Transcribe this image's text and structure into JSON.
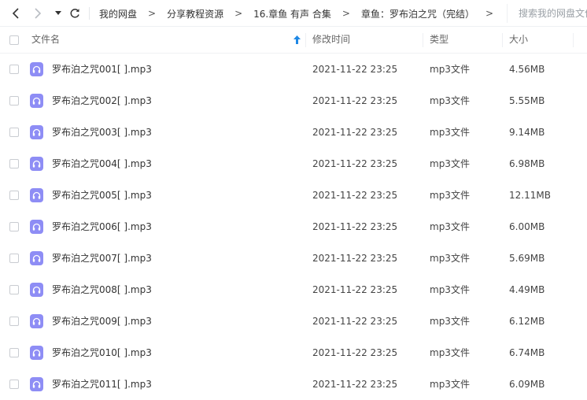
{
  "breadcrumb": [
    "我的网盘",
    "分享教程资源",
    "16.章鱼 有声 合集",
    "章鱼：罗布泊之咒（完结）"
  ],
  "breadcrumb_sep": ">",
  "search": {
    "placeholder": "搜索我的网盘文件"
  },
  "columns": {
    "name": "文件名",
    "modified": "修改时间",
    "type": "类型",
    "size": "大小"
  },
  "files": [
    {
      "name": "罗布泊之咒001[ ].mp3",
      "modified": "2021-11-22 23:25",
      "type": "mp3文件",
      "size": "4.56MB"
    },
    {
      "name": "罗布泊之咒002[ ].mp3",
      "modified": "2021-11-22 23:25",
      "type": "mp3文件",
      "size": "5.55MB"
    },
    {
      "name": "罗布泊之咒003[ ].mp3",
      "modified": "2021-11-22 23:25",
      "type": "mp3文件",
      "size": "9.14MB"
    },
    {
      "name": "罗布泊之咒004[ ].mp3",
      "modified": "2021-11-22 23:25",
      "type": "mp3文件",
      "size": "6.98MB"
    },
    {
      "name": "罗布泊之咒005[ ].mp3",
      "modified": "2021-11-22 23:25",
      "type": "mp3文件",
      "size": "12.11MB"
    },
    {
      "name": "罗布泊之咒006[ ].mp3",
      "modified": "2021-11-22 23:25",
      "type": "mp3文件",
      "size": "6.00MB"
    },
    {
      "name": "罗布泊之咒007[ ].mp3",
      "modified": "2021-11-22 23:25",
      "type": "mp3文件",
      "size": "5.69MB"
    },
    {
      "name": "罗布泊之咒008[ ].mp3",
      "modified": "2021-11-22 23:25",
      "type": "mp3文件",
      "size": "4.49MB"
    },
    {
      "name": "罗布泊之咒009[ ].mp3",
      "modified": "2021-11-22 23:25",
      "type": "mp3文件",
      "size": "6.12MB"
    },
    {
      "name": "罗布泊之咒010[ ].mp3",
      "modified": "2021-11-22 23:25",
      "type": "mp3文件",
      "size": "6.74MB"
    },
    {
      "name": "罗布泊之咒011[ ].mp3",
      "modified": "2021-11-22 23:25",
      "type": "mp3文件",
      "size": "6.09MB"
    }
  ],
  "icons": {
    "file": "headphones-icon",
    "back": "chevron-left-icon",
    "forward": "chevron-right-icon",
    "history": "caret-down-icon",
    "refresh": "refresh-icon",
    "sort": "sort-ascending-icon"
  },
  "colors": {
    "file_icon": "#8e8df5",
    "sort_arrow": "#1e88e5"
  }
}
